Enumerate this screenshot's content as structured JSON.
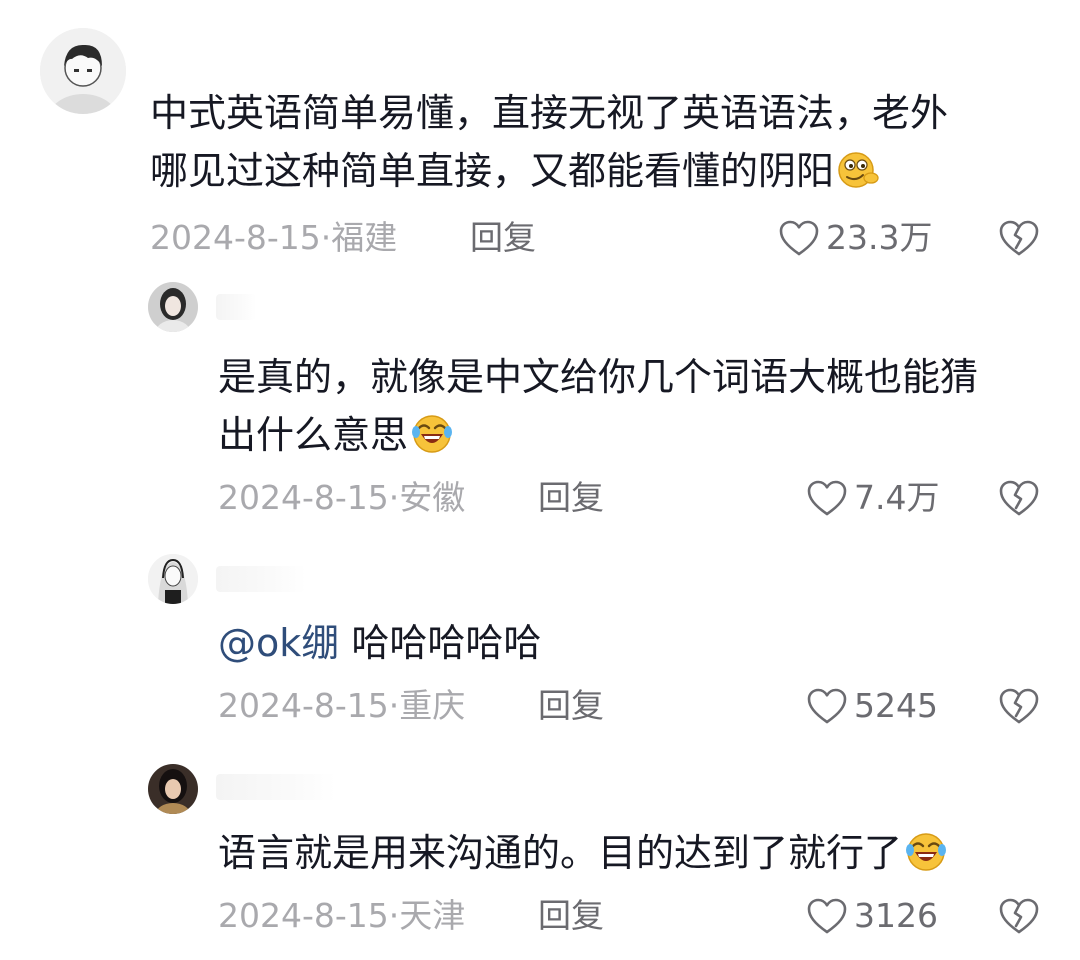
{
  "comments": [
    {
      "text_lines": [
        "中式英语简单易懂，直接无视了英语语法，老外",
        "哪见过这种简单直接，又都能看懂的阴阳"
      ],
      "emoji": "smirking-face-emoji",
      "date": "2024-8-15",
      "location": "福建",
      "reply_label": "回复",
      "likes": "23.3万"
    }
  ],
  "replies": [
    {
      "text_lines": [
        "是真的，就像是中文给你几个词语大概也能猜",
        "出什么意思"
      ],
      "emoji": "rolling-laughing-emoji",
      "date": "2024-8-15",
      "location": "安徽",
      "reply_label": "回复",
      "likes": "7.4万"
    },
    {
      "mention": "@ok绷",
      "text": "哈哈哈哈哈",
      "date": "2024-8-15",
      "location": "重庆",
      "reply_label": "回复",
      "likes": "5245"
    },
    {
      "text_lines": [
        "语言就是用来沟通的。目的达到了就行了"
      ],
      "emoji": "rolling-laughing-emoji",
      "date": "2024-8-15",
      "location": "天津",
      "reply_label": "回复",
      "likes": "3126"
    }
  ],
  "meta_separator": "·",
  "colors": {
    "text": "#161823",
    "meta": "#a9a9ad",
    "action": "#6b6b70",
    "mention": "#2f4d7a"
  }
}
